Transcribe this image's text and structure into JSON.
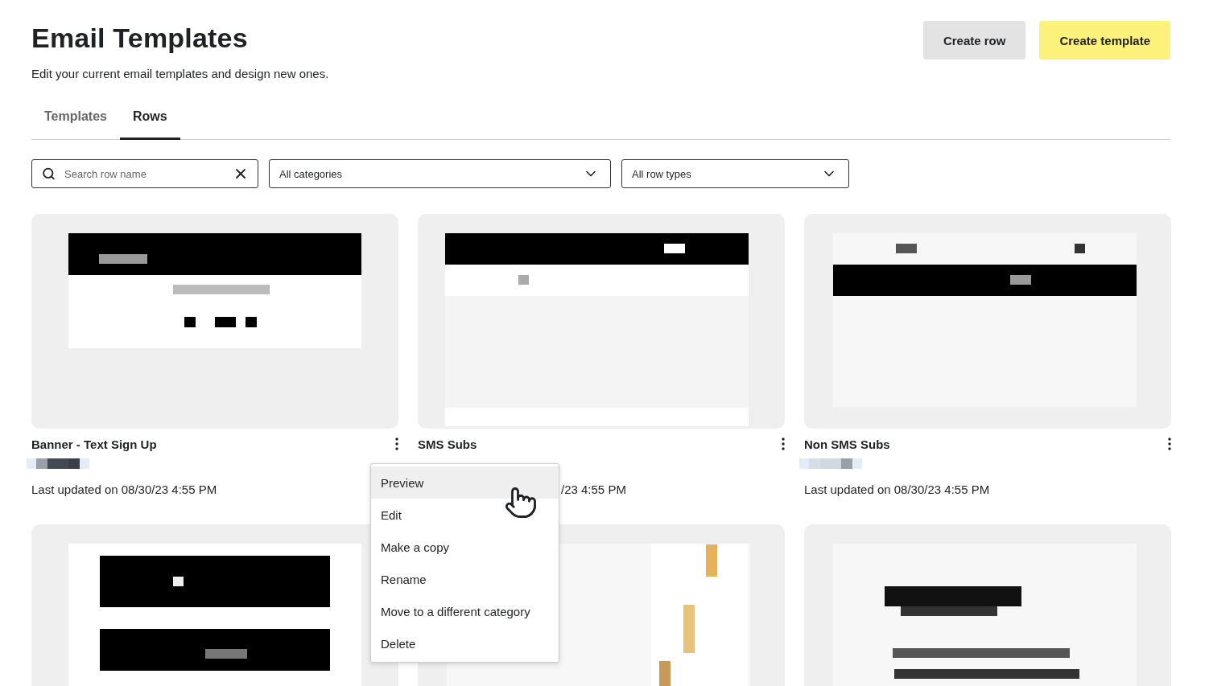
{
  "header": {
    "title": "Email Templates",
    "subtitle": "Edit your current email templates and design new ones.",
    "buttons": [
      {
        "label": "Create row",
        "kind": "secondary"
      },
      {
        "label": "Create template",
        "kind": "primary"
      }
    ]
  },
  "tabs": [
    {
      "label": "Templates",
      "selected": false
    },
    {
      "label": "Rows",
      "selected": true
    }
  ],
  "filters": {
    "search": {
      "placeholder": "Search row name"
    },
    "selects": [
      {
        "value": "All categories"
      },
      {
        "value": "All row types"
      }
    ]
  },
  "cards": [
    {
      "kind": "full",
      "title": "Banner - Text Sign Up",
      "updated": "Last updated on 08/30/23 4:55 PM",
      "partly_hidden": false
    },
    {
      "kind": "full",
      "title": "SMS Subs",
      "updated": "/23 4:55 PM",
      "partly_hidden": true
    },
    {
      "kind": "full",
      "title": "Non SMS Subs",
      "updated": "Last updated on 08/30/23 4:55 PM",
      "partly_hidden": false
    },
    {
      "kind": "thumbnail_only"
    },
    {
      "kind": "thumbnail_only"
    },
    {
      "kind": "thumbnail_only"
    }
  ],
  "context_menu": {
    "items": [
      {
        "label": "Preview",
        "selected": true
      },
      {
        "label": "Edit",
        "selected": false
      },
      {
        "label": "Make a copy",
        "selected": false
      },
      {
        "label": "Rename",
        "selected": false
      },
      {
        "label": "Move to a different category",
        "selected": false
      },
      {
        "label": "Delete",
        "selected": false
      }
    ]
  }
}
